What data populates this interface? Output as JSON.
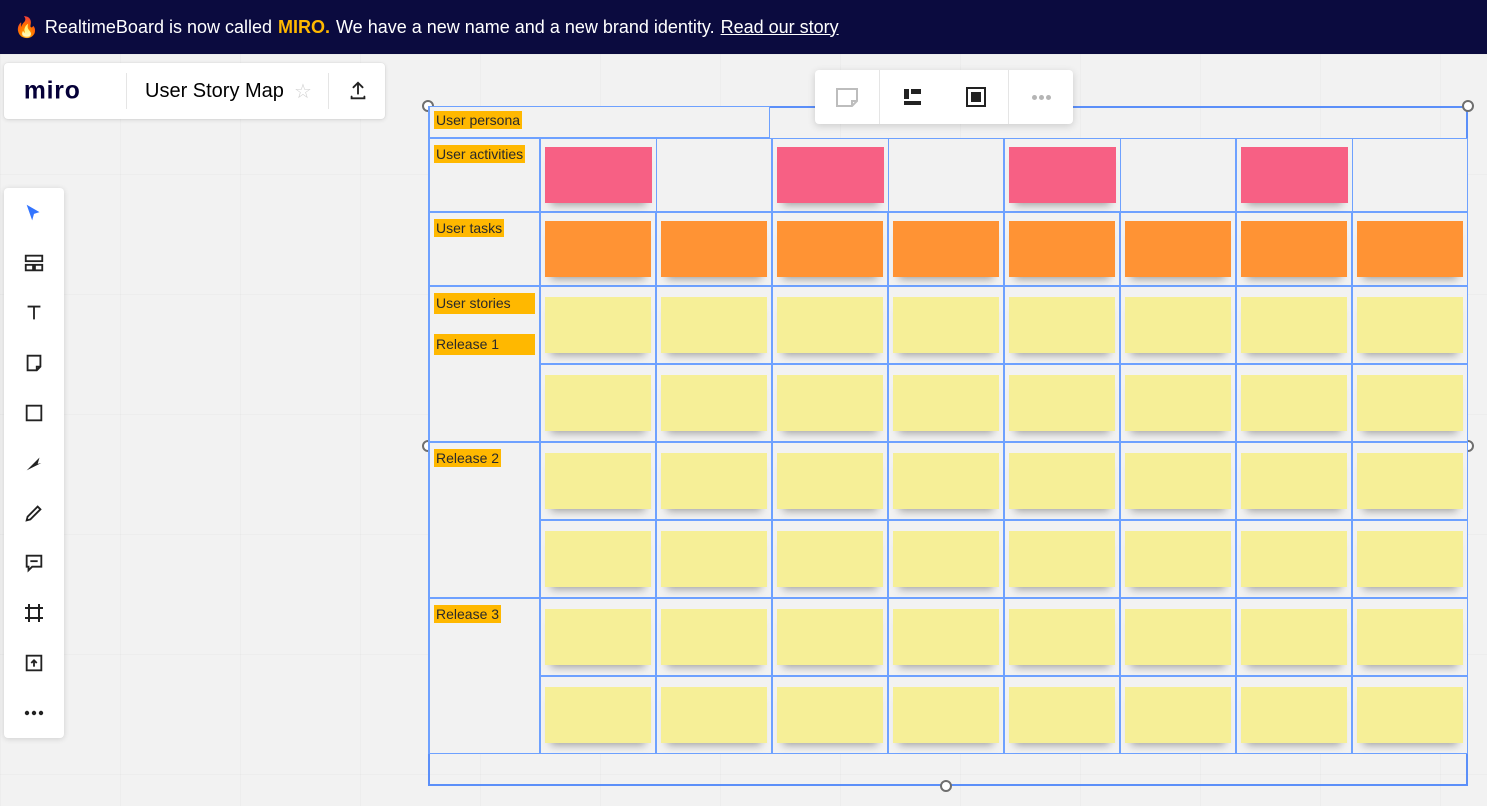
{
  "banner": {
    "prefix": "RealtimeBoard is now called",
    "brand": "MIRO.",
    "suffix": "We have a new name and a new brand identity.",
    "link": "Read our story"
  },
  "header": {
    "logo_alt": "miro",
    "board_title": "User Story Map"
  },
  "map": {
    "labels": {
      "persona": "User persona",
      "activities": "User activities",
      "tasks": "User tasks",
      "stories_r1_a": "User stories",
      "stories_r1_b": "Release 1",
      "release2": "Release 2",
      "release3": "Release 3"
    }
  },
  "toolbar_icons": {
    "select": "select-icon",
    "templates": "templates-icon",
    "text": "text-icon",
    "sticky": "sticky-icon",
    "shape": "shape-icon",
    "arrow": "arrow-icon",
    "pen": "pen-icon",
    "comment": "comment-icon",
    "frame": "frame-icon",
    "upload": "upload-icon",
    "more": "more-icon"
  }
}
